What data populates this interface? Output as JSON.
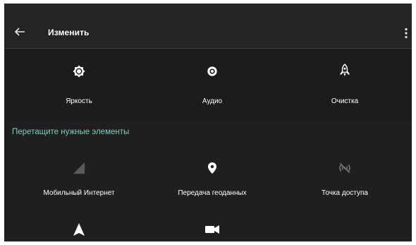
{
  "toolbar": {
    "title": "Изменить",
    "back_icon": "arrow-left-icon",
    "menu_icon": "more-vert-icon"
  },
  "active_tiles": [
    {
      "label": "Яркость",
      "icon": "brightness-icon"
    },
    {
      "label": "Аудио",
      "icon": "speaker-icon"
    },
    {
      "label": "Очистка",
      "icon": "rocket-icon"
    }
  ],
  "drag_hint": "Перетащите нужные элементы",
  "available_tiles": [
    {
      "label": "Мобильный Интернет",
      "icon": "signal-icon"
    },
    {
      "label": "Передача геоданных",
      "icon": "location-pin-icon"
    },
    {
      "label": "Точка доступа",
      "icon": "hotspot-off-icon"
    },
    {
      "label": "",
      "icon": "navigation-icon"
    },
    {
      "label": "",
      "icon": "video-camera-icon"
    }
  ],
  "colors": {
    "accent": "#7fcbc0",
    "background": "#1f1f1f",
    "toolbar": "#242424",
    "text": "#ffffff",
    "disabled_icon": "#5a5a5a"
  }
}
